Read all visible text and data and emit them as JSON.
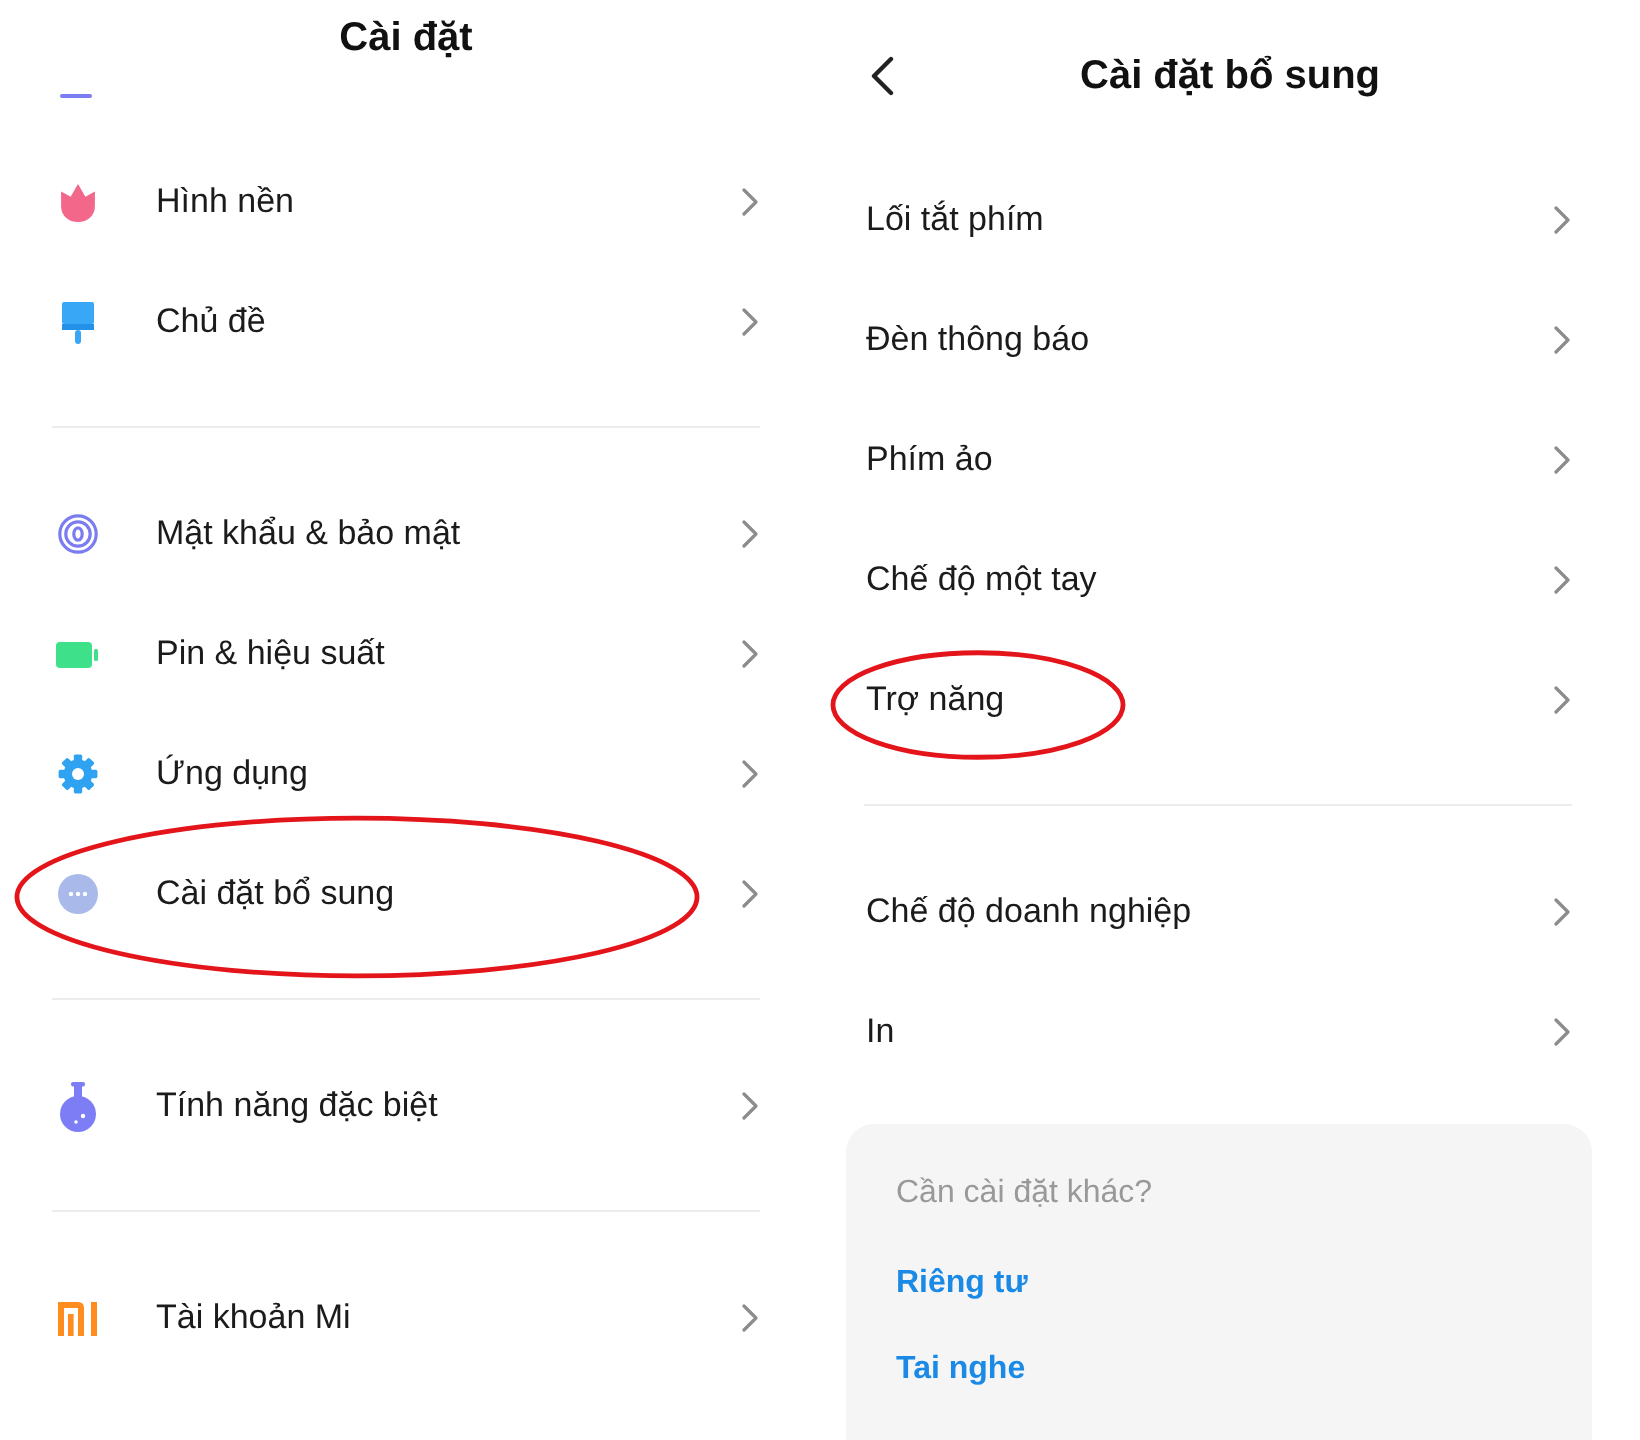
{
  "left_screen": {
    "title": "Cài đặt",
    "sections": [
      {
        "items": [
          {
            "label": "Hình nền",
            "circled": false
          },
          {
            "label": "Chủ đề",
            "circled": false
          }
        ]
      },
      {
        "items": [
          {
            "label": "Mật khẩu & bảo mật",
            "circled": false
          },
          {
            "label": "Pin & hiệu suất",
            "circled": false
          },
          {
            "label": "Ứng dụng",
            "circled": false
          },
          {
            "label": "Cài đặt bổ sung",
            "circled": true
          }
        ]
      },
      {
        "items": [
          {
            "label": "Tính năng đặc biệt",
            "circled": false
          }
        ]
      },
      {
        "items": [
          {
            "label": "Tài khoản Mi",
            "circled": false
          }
        ]
      }
    ]
  },
  "right_screen": {
    "title": "Cài đặt bổ sung",
    "sections": [
      {
        "items": [
          {
            "label": "Lối tắt phím",
            "circled": false
          },
          {
            "label": "Đèn thông báo",
            "circled": false
          },
          {
            "label": "Phím ảo",
            "circled": false
          },
          {
            "label": "Chế độ một tay",
            "circled": false
          },
          {
            "label": "Trợ năng",
            "circled": true
          }
        ]
      },
      {
        "items": [
          {
            "label": "Chế độ doanh nghiệp",
            "circled": false
          },
          {
            "label": "In",
            "circled": false
          }
        ]
      }
    ],
    "suggestions": {
      "heading": "Cần cài đặt khác?",
      "links": [
        "Riêng tư",
        "Tai nghe"
      ]
    }
  }
}
